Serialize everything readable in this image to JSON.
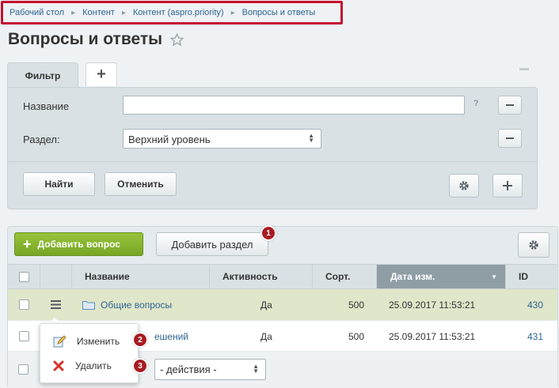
{
  "breadcrumb": {
    "items": [
      "Рабочий стол",
      "Контент",
      "Контент (aspro.priority)",
      "Вопросы и ответы"
    ]
  },
  "page": {
    "title": "Вопросы и ответы"
  },
  "filter": {
    "tab_label": "Фильтр",
    "add_tab": "+",
    "name_label": "Название",
    "name_value": "",
    "help": "?",
    "section_label": "Раздел:",
    "section_value": "Верхний уровень",
    "find_button": "Найти",
    "cancel_button": "Отменить"
  },
  "list": {
    "add_question": "Добавить вопрос",
    "add_section": "Добавить раздел",
    "columns": {
      "name": "Название",
      "active": "Активность",
      "sort": "Сорт.",
      "date": "Дата изм.",
      "id": "ID"
    },
    "rows": [
      {
        "name": "Общие вопросы",
        "active": "Да",
        "sort": "500",
        "date": "25.09.2017 11:53:21",
        "id": "430"
      },
      {
        "name": "ешений",
        "active": "Да",
        "sort": "500",
        "date": "25.09.2017 11:53:21",
        "id": "431"
      }
    ],
    "actions_placeholder": "- действия -"
  },
  "context_menu": {
    "items": [
      {
        "label": "Изменить",
        "icon": "edit-icon"
      },
      {
        "label": "Удалить",
        "icon": "delete-icon"
      }
    ]
  },
  "badges": [
    "1",
    "2",
    "3"
  ],
  "colors": {
    "highlight": "#c41230",
    "accent_green": "#86b52f",
    "badge": "#a81b22",
    "link": "#2d6591",
    "row_selected": "#e0e6ca"
  }
}
